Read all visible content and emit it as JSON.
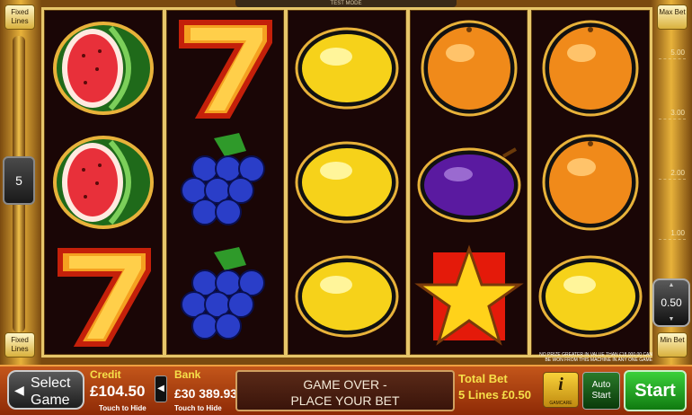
{
  "header": {
    "test_mode": "TEST MODE"
  },
  "left_rail": {
    "fixed_lines_top": "Fixed Lines",
    "fixed_lines_bottom": "Fixed Lines",
    "lines_count": "5"
  },
  "right_rail": {
    "max_bet": "Max Bet",
    "min_bet": "Min Bet",
    "scale": [
      "5.00",
      "3.00",
      "2.00",
      "1.00"
    ],
    "current_bet": "0.50"
  },
  "reels": [
    [
      "watermelon",
      "watermelon",
      "seven"
    ],
    [
      "seven",
      "grapes",
      "grapes"
    ],
    [
      "lemon",
      "lemon",
      "lemon"
    ],
    [
      "orange",
      "plum",
      "star"
    ],
    [
      "orange",
      "orange",
      "lemon"
    ]
  ],
  "win_notice": "NO PRIZE GREATER IN VALUE THAN £18,000.00 CAN BE WON FROM THIS MACHINE IN ANY ONE GAME",
  "bottom_bar": {
    "select_game": "Select Game",
    "credit_label": "Credit",
    "credit_value": "£104.50",
    "credit_hint": "Touch to Hide",
    "bank_label": "Bank",
    "bank_value": "£30 389.93",
    "bank_hint": "Touch to Hide",
    "message_line1": "GAME OVER -",
    "message_line2": "PLACE YOUR BET",
    "total_bet_label": "Total Bet",
    "total_bet_value": "5 Lines £0.50",
    "info": "i",
    "info_sub": "GAMCARE",
    "auto_start": "Auto Start",
    "start": "Start"
  },
  "colors": {
    "frame_gold": "#e8b23a",
    "reel_bg": "#1a0606",
    "bottom_bar": "#c4561a",
    "start_green": "#3bd03b"
  }
}
